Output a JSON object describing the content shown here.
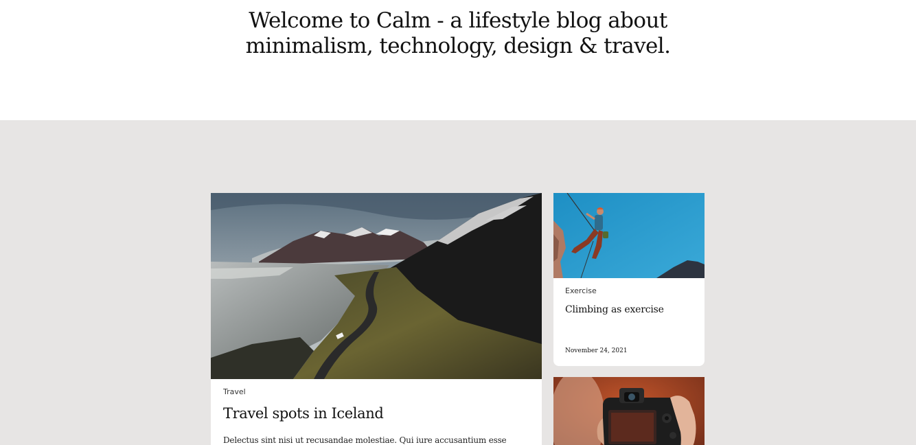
{
  "hero": {
    "title_line1": "Welcome to Calm - a lifestyle blog about",
    "title_line2": "minimalism, technology, design & travel."
  },
  "featured": {
    "image": "iceland-mountain-road-photo",
    "category": "Travel",
    "title": "Travel spots in Iceland",
    "excerpt": "Delectus sint nisi ut recusandae molestiae. Qui iure accusantium esse"
  },
  "side_posts": [
    {
      "image": "rock-climber-photo",
      "category": "Exercise",
      "title": "Climbing as exercise",
      "date": "November 24, 2021"
    },
    {
      "image": "camera-in-hands-photo"
    }
  ],
  "colors": {
    "feed_background": "#e7e5e4",
    "card_background": "#ffffff",
    "text": "#111111"
  }
}
